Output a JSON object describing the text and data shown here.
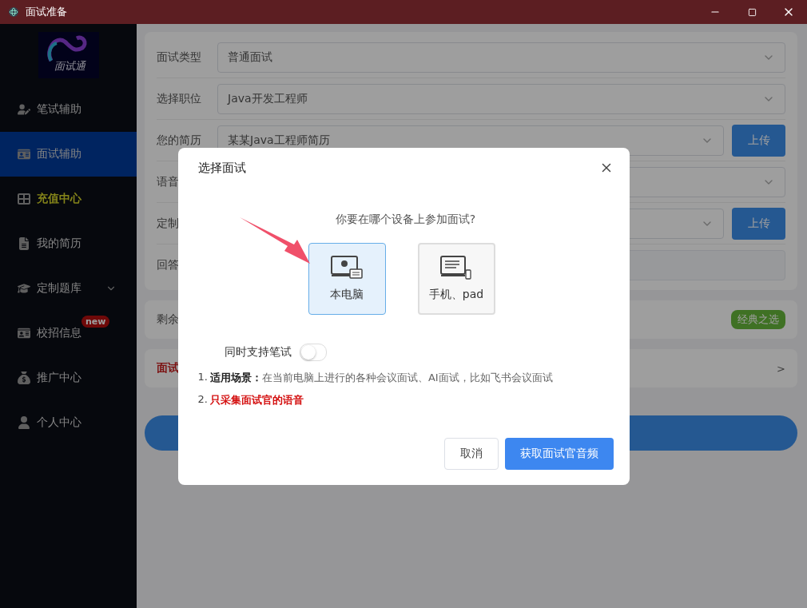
{
  "window": {
    "title": "面试准备"
  },
  "sidebar": {
    "logo_text": "面试通",
    "items": [
      {
        "label": "笔试辅助",
        "selected": false,
        "highlight": false
      },
      {
        "label": "面试辅助",
        "selected": true,
        "highlight": false
      },
      {
        "label": "充值中心",
        "selected": false,
        "highlight": true
      },
      {
        "label": "我的简历",
        "selected": false,
        "highlight": false
      },
      {
        "label": "定制题库",
        "selected": false,
        "highlight": false,
        "expanded": false
      },
      {
        "label": "校招信息",
        "selected": false,
        "highlight": false,
        "badge": "new"
      },
      {
        "label": "推广中心",
        "selected": false,
        "highlight": false
      },
      {
        "label": "个人中心",
        "selected": false,
        "highlight": false
      }
    ]
  },
  "form": {
    "rows": [
      {
        "kind": "select",
        "label": "面试类型",
        "value": "普通面试"
      },
      {
        "kind": "select",
        "label": "选择职位",
        "value": "Java开发工程师"
      },
      {
        "kind": "upload",
        "label": "您的简历",
        "value": "某某Java工程师简历",
        "button": "上传"
      },
      {
        "kind": "select",
        "label": "语音"
      },
      {
        "kind": "upload",
        "label": "定制",
        "button": "上传"
      },
      {
        "kind": "input",
        "label": "回答"
      }
    ]
  },
  "remaining": {
    "label": "剩余",
    "badge": "经典之选"
  },
  "interview_row": {
    "label": "面试",
    "chevron": ">"
  },
  "dialog": {
    "title": "选择面试",
    "question": "你要在哪个设备上参加面试?",
    "devices": [
      {
        "label": "本电脑",
        "selected": true
      },
      {
        "label": "手机、pad",
        "selected": false
      }
    ],
    "toggle": {
      "label": "同时支持笔试",
      "on": false
    },
    "notes": [
      {
        "number": "1.",
        "text": "**适用场景：**在当前电脑上进行的各种会议面试、AI面试，比如飞书会议面试",
        "emphasis": false
      },
      {
        "number": "2.",
        "text": "只采集面试官的语音",
        "emphasis": true
      }
    ],
    "buttons": [
      {
        "label": "取消",
        "primary": false
      },
      {
        "label": "获取面试官音频",
        "primary": true
      }
    ]
  }
}
